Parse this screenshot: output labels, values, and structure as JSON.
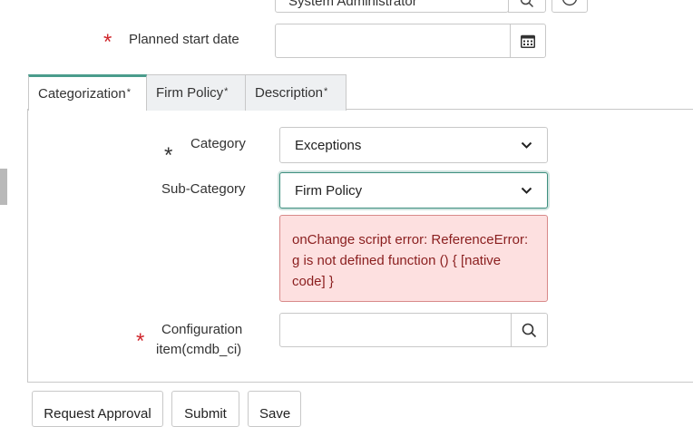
{
  "top_row": {
    "value": "System Administrator"
  },
  "planned_start": {
    "label": "Planned start date",
    "value": ""
  },
  "tabs": [
    {
      "label": "Categorization",
      "mark": "*"
    },
    {
      "label": "Firm Policy",
      "mark": "*"
    },
    {
      "label": "Description",
      "mark": "*"
    }
  ],
  "category": {
    "label": "Category",
    "value": "Exceptions"
  },
  "sub_category": {
    "label": "Sub-Category",
    "value": "Firm Policy"
  },
  "error": {
    "message": "onChange script error: ReferenceError: g is not defined function () { [native code] }"
  },
  "configuration_item": {
    "label_line1": "Configuration",
    "label_line2": "item(cmdb_ci)",
    "value": ""
  },
  "buttons": {
    "request_approval": "Request Approval",
    "submit": "Submit",
    "save": "Save"
  },
  "required_mark": "*",
  "colors": {
    "required": "#d0272d",
    "accent": "#4a9c8c",
    "error_bg": "#fde0e0",
    "error_text": "#8a1e1e"
  },
  "icons": {
    "calendar": "calendar-icon",
    "search": "search-icon",
    "info": "info-icon",
    "chevron": "chevron-down-icon"
  }
}
